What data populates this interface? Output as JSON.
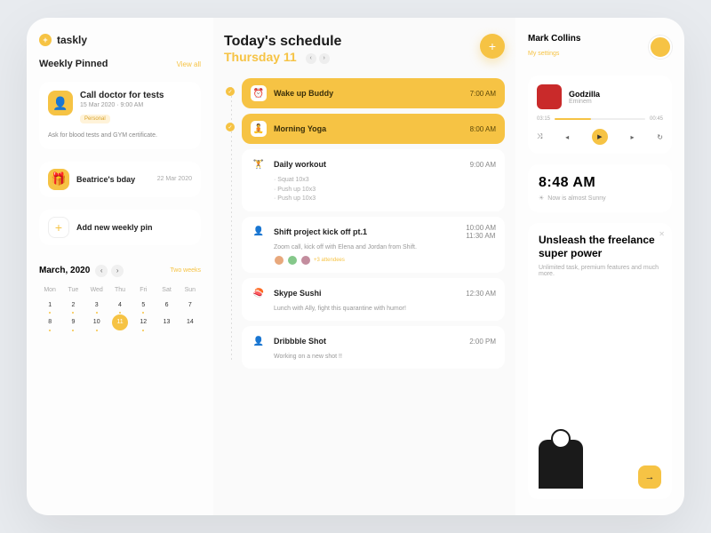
{
  "brand": "taskly",
  "left": {
    "pinned_title": "Weekly Pinned",
    "view_all": "View all",
    "pins": [
      {
        "title": "Call doctor for tests",
        "date": "15 Mar 2020 · 9:00 AM",
        "tag": "Personal",
        "desc": "Ask for blood tests and GYM certificate."
      },
      {
        "title": "Beatrice's bday",
        "date": "22 Mar 2020"
      }
    ],
    "add_pin": "Add new weekly pin",
    "calendar": {
      "month": "March, 2020",
      "two_weeks": "Two weeks",
      "days": [
        "Mon",
        "Tue",
        "Wed",
        "Thu",
        "Fri",
        "Sat",
        "Sun"
      ],
      "rows": [
        [
          1,
          2,
          3,
          4,
          5,
          6,
          7
        ],
        [
          8,
          9,
          10,
          11,
          12,
          13,
          14
        ]
      ],
      "selected": 11,
      "dotted": [
        1,
        2,
        3,
        4,
        5,
        8,
        9,
        10,
        12
      ]
    }
  },
  "mid": {
    "title": "Today's schedule",
    "subtitle": "Thursday 11",
    "tasks": [
      {
        "name": "Wake up Buddy",
        "time": "7:00 AM",
        "hl": true,
        "icon": "⏰",
        "done": true
      },
      {
        "name": "Morning Yoga",
        "time": "8:00 AM",
        "hl": true,
        "icon": "🧘",
        "done": true
      },
      {
        "name": "Daily workout",
        "time": "9:00 AM",
        "icon": "🏋",
        "bullets": [
          "Squat 10x3",
          "Push up 10x3",
          "Push up 10x3"
        ]
      },
      {
        "name": "Shift project kick off pt.1",
        "time": "10:00 AM",
        "time2": "11:30 AM",
        "icon": "👤",
        "desc": "Zoom call, kick off with Elena and Jordan from Shift.",
        "attendees": 3,
        "more": "+3 attendees"
      },
      {
        "name": "Skype Sushi",
        "time": "12:30 AM",
        "icon": "🍣",
        "desc": "Lunch with Ally, fight this quarantine with humor!"
      },
      {
        "name": "Dribbble Shot",
        "time": "2:00 PM",
        "icon": "👤",
        "desc": "Working on a new shot !!"
      }
    ]
  },
  "right": {
    "user": {
      "name": "Mark Collins",
      "settings": "My settings"
    },
    "player": {
      "track": "Godzilla",
      "artist": "Eminem",
      "elapsed": "03:15",
      "total": "00:45"
    },
    "clock": {
      "time": "8:48 AM",
      "weather": "Now is almost Sunny"
    },
    "promo": {
      "title": "Unsleash the freelance super power",
      "desc": "Unlimited task, premium features and much more."
    }
  }
}
